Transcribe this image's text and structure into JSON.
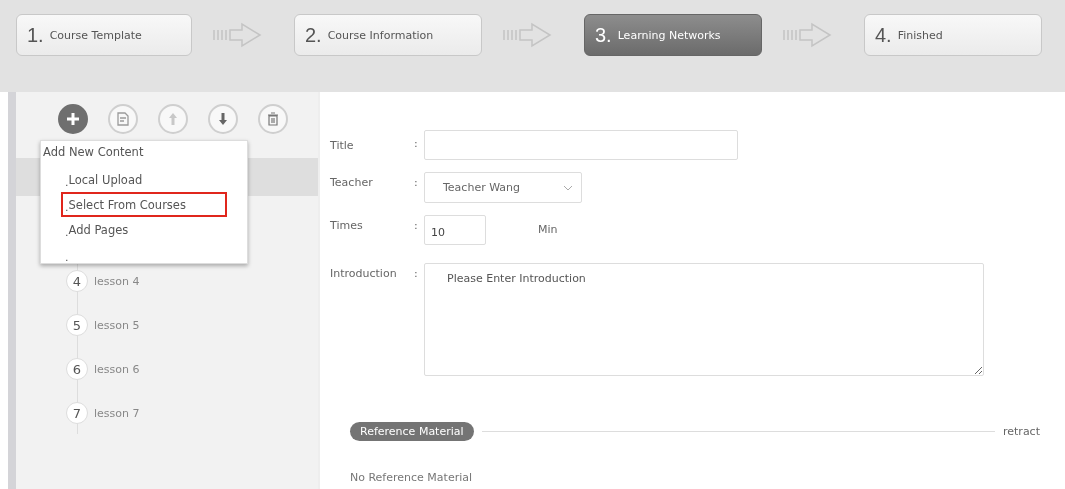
{
  "steps": [
    {
      "number": "1.",
      "label": "Course Template",
      "selected": false
    },
    {
      "number": "2.",
      "label": "Course Information",
      "selected": false
    },
    {
      "number": "3.",
      "label": "Learning Networks",
      "selected": true
    },
    {
      "number": "4.",
      "label": "Finished",
      "selected": false
    }
  ],
  "toolbar": [
    {
      "kind": "add",
      "selected": true
    },
    {
      "kind": "edit",
      "selected": false
    },
    {
      "kind": "up",
      "selected": false
    },
    {
      "kind": "down",
      "selected": false
    },
    {
      "kind": "delete",
      "selected": false
    }
  ],
  "menu": {
    "title": "Add New Content",
    "items": [
      {
        "bullet": ".",
        "label": "Local Upload",
        "highlighted": false
      },
      {
        "bullet": ".",
        "label": "Select From Courses",
        "highlighted": true
      },
      {
        "bullet": ".",
        "label": "Add Pages",
        "highlighted": false
      },
      {
        "bullet": ".",
        "highlighted": false
      }
    ]
  },
  "lessons": [
    {
      "number": "4",
      "label": "lesson 4"
    },
    {
      "number": "5",
      "label": "lesson 5"
    },
    {
      "number": "6",
      "label": "lesson 6"
    },
    {
      "number": "7",
      "label": "lesson 7"
    }
  ],
  "form": {
    "title": {
      "label": "Title",
      "colon": ":"
    },
    "teacher": {
      "label": "Teacher",
      "colon": ":",
      "value": "Teacher Wang"
    },
    "times": {
      "label": "Times",
      "colon": ":",
      "value": "10",
      "unit": "Min"
    },
    "introduction": {
      "label": "Introduction",
      "colon": ":",
      "placeholder": "Please Enter Introduction"
    }
  },
  "reference": {
    "title": "Reference Material",
    "action": "retract",
    "empty": "No Reference Material"
  }
}
